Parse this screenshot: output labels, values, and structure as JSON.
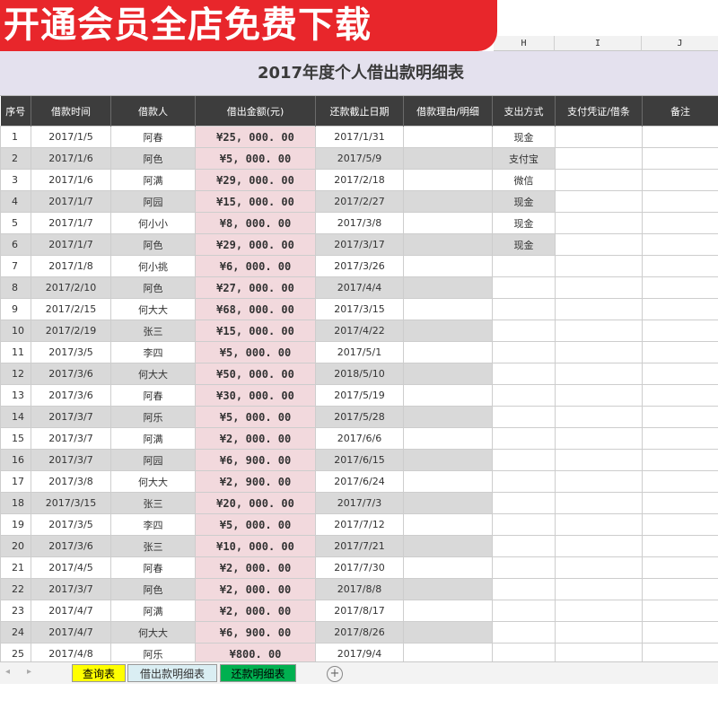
{
  "banner": {
    "text": "开通会员全店免费下载"
  },
  "col_letters": [
    "H",
    "I",
    "J"
  ],
  "title": "2017年度个人借出款明细表",
  "headers": [
    "序号",
    "借款时间",
    "借款人",
    "借出金额(元)",
    "还款截止日期",
    "借款理由/明细",
    "支出方式",
    "支付凭证/借条",
    "备注"
  ],
  "rows": [
    [
      "1",
      "2017/1/5",
      "阿春",
      "¥25, 000. 00",
      "2017/1/31",
      "",
      "现金",
      "",
      ""
    ],
    [
      "2",
      "2017/1/6",
      "阿色",
      "¥5, 000. 00",
      "2017/5/9",
      "",
      "支付宝",
      "",
      ""
    ],
    [
      "3",
      "2017/1/6",
      "阿满",
      "¥29, 000. 00",
      "2017/2/18",
      "",
      "微信",
      "",
      ""
    ],
    [
      "4",
      "2017/1/7",
      "阿园",
      "¥15, 000. 00",
      "2017/2/27",
      "",
      "现金",
      "",
      ""
    ],
    [
      "5",
      "2017/1/7",
      "何小小",
      "¥8, 000. 00",
      "2017/3/8",
      "",
      "现金",
      "",
      ""
    ],
    [
      "6",
      "2017/1/7",
      "阿色",
      "¥29, 000. 00",
      "2017/3/17",
      "",
      "现金",
      "",
      ""
    ],
    [
      "7",
      "2017/1/8",
      "何小挑",
      "¥6, 000. 00",
      "2017/3/26",
      "",
      "",
      "",
      ""
    ],
    [
      "8",
      "2017/2/10",
      "阿色",
      "¥27, 000. 00",
      "2017/4/4",
      "",
      "",
      "",
      ""
    ],
    [
      "9",
      "2017/2/15",
      "何大大",
      "¥68, 000. 00",
      "2017/3/15",
      "",
      "",
      "",
      ""
    ],
    [
      "10",
      "2017/2/19",
      "张三",
      "¥15, 000. 00",
      "2017/4/22",
      "",
      "",
      "",
      ""
    ],
    [
      "11",
      "2017/3/5",
      "李四",
      "¥5, 000. 00",
      "2017/5/1",
      "",
      "",
      "",
      ""
    ],
    [
      "12",
      "2017/3/6",
      "何大大",
      "¥50, 000. 00",
      "2018/5/10",
      "",
      "",
      "",
      ""
    ],
    [
      "13",
      "2017/3/6",
      "阿春",
      "¥30, 000. 00",
      "2017/5/19",
      "",
      "",
      "",
      ""
    ],
    [
      "14",
      "2017/3/7",
      "阿乐",
      "¥5, 000. 00",
      "2017/5/28",
      "",
      "",
      "",
      ""
    ],
    [
      "15",
      "2017/3/7",
      "阿满",
      "¥2, 000. 00",
      "2017/6/6",
      "",
      "",
      "",
      ""
    ],
    [
      "16",
      "2017/3/7",
      "阿园",
      "¥6, 900. 00",
      "2017/6/15",
      "",
      "",
      "",
      ""
    ],
    [
      "17",
      "2017/3/8",
      "何大大",
      "¥2, 900. 00",
      "2017/6/24",
      "",
      "",
      "",
      ""
    ],
    [
      "18",
      "2017/3/15",
      "张三",
      "¥20, 000. 00",
      "2017/7/3",
      "",
      "",
      "",
      ""
    ],
    [
      "19",
      "2017/3/5",
      "李四",
      "¥5, 000. 00",
      "2017/7/12",
      "",
      "",
      "",
      ""
    ],
    [
      "20",
      "2017/3/6",
      "张三",
      "¥10, 000. 00",
      "2017/7/21",
      "",
      "",
      "",
      ""
    ],
    [
      "21",
      "2017/4/5",
      "阿春",
      "¥2, 000. 00",
      "2017/7/30",
      "",
      "",
      "",
      ""
    ],
    [
      "22",
      "2017/3/7",
      "阿色",
      "¥2, 000. 00",
      "2017/8/8",
      "",
      "",
      "",
      ""
    ],
    [
      "23",
      "2017/4/7",
      "阿满",
      "¥2, 000. 00",
      "2017/8/17",
      "",
      "",
      "",
      ""
    ],
    [
      "24",
      "2017/4/7",
      "何大大",
      "¥6, 900. 00",
      "2017/8/26",
      "",
      "",
      "",
      ""
    ],
    [
      "25",
      "2017/4/8",
      "阿乐",
      "¥800. 00",
      "2017/9/4",
      "",
      "",
      "",
      ""
    ]
  ],
  "tabs": [
    {
      "label": "查询表",
      "bg": "#ffff00",
      "color": "#000000"
    },
    {
      "label": "借出款明细表",
      "bg": "#daeef3",
      "color": "#333333"
    },
    {
      "label": "还款明细表",
      "bg": "#00b050",
      "color": "#000000"
    }
  ],
  "colors": {
    "banner": "#e8262b",
    "header_bg": "#3d3d3d",
    "amount_bg": "#f2d9dd",
    "title_bg": "#e4e1ee",
    "grey_row": "#d9d9d9"
  },
  "icons": {
    "nav_prev": "◂",
    "nav_next": "▸",
    "add_sheet": "+"
  }
}
